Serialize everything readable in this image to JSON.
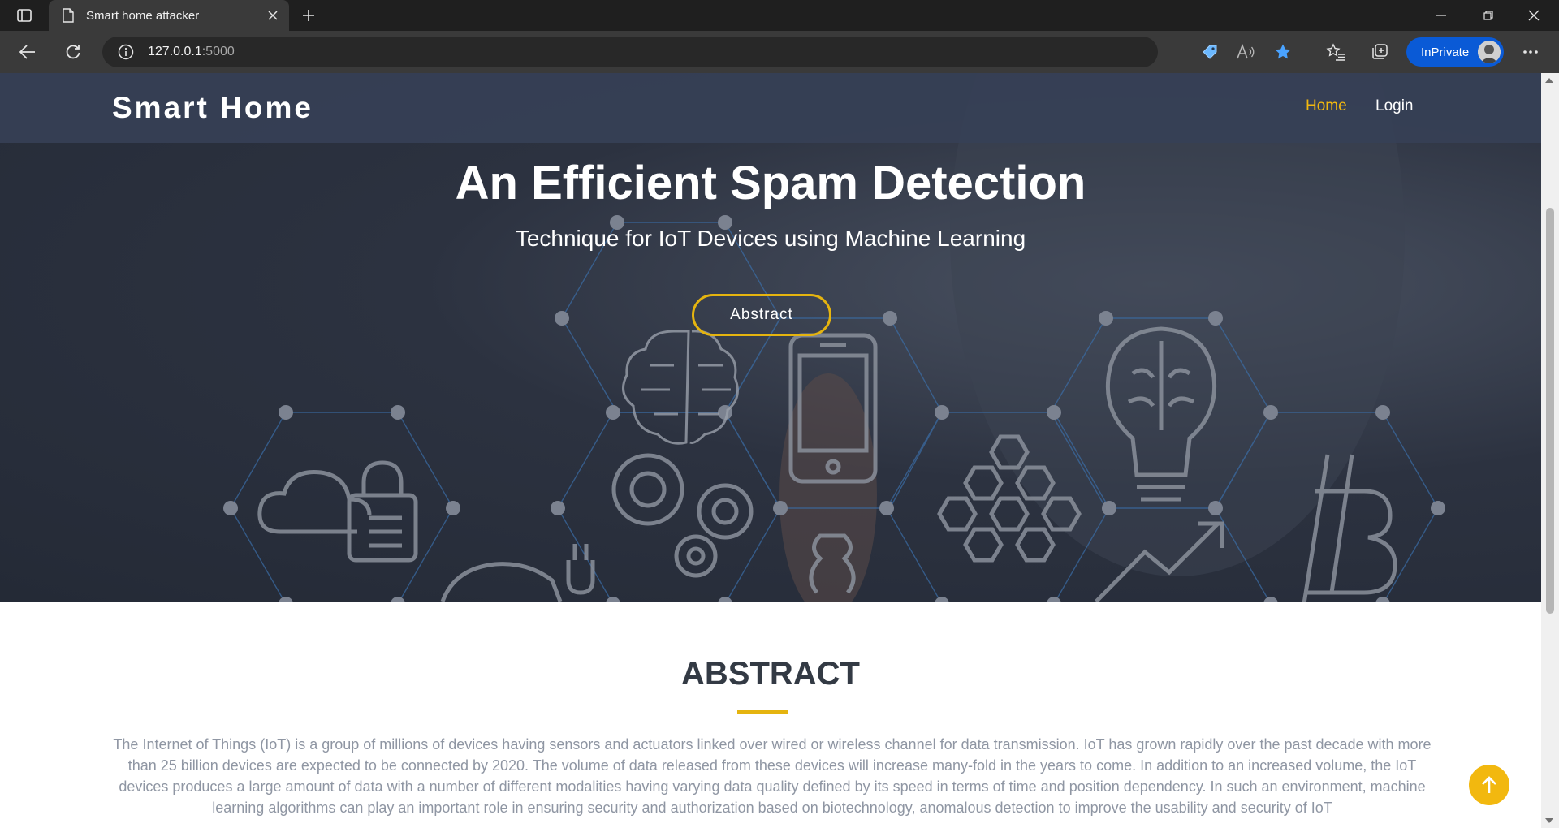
{
  "browser": {
    "tab_title": "Smart home attacker",
    "url_host": "127.0.0.1",
    "url_port": ":5000",
    "inprivate_label": "InPrivate"
  },
  "site": {
    "brand": "Smart Home",
    "nav": {
      "home": "Home",
      "login": "Login"
    },
    "accent_color": "#f2b80f"
  },
  "hero": {
    "title": "An Efficient Spam Detection",
    "subtitle": "Technique for IoT Devices using Machine Learning",
    "button_label": "Abstract"
  },
  "abstract": {
    "heading": "ABSTRACT",
    "body": "The Internet of Things (IoT) is a group of millions of devices having sensors and actuators linked over wired or wireless channel for data transmission. IoT has grown rapidly over the past decade with more than 25 billion devices are expected to be connected by 2020. The volume of data released from these devices will increase many-fold in the years to come. In addition to an increased volume, the IoT devices produces a large amount of data with a number of different modalities having varying data quality defined by its speed in terms of time and position dependency. In such an environment, machine learning algorithms can play an important role in ensuring security and authorization based on biotechnology, anomalous detection to improve the usability and security of IoT"
  },
  "icons": {
    "back_to_top": "arrow-up-icon",
    "hero_graphics": [
      "brain-icon",
      "cloud-lock-icon",
      "gears-icon",
      "smartphone-icon",
      "hexagons-icon",
      "lightbulb-brain-icon",
      "bitcoin-icon",
      "car-plug-icon",
      "money-bag-icon",
      "chart-arrow-icon"
    ]
  }
}
